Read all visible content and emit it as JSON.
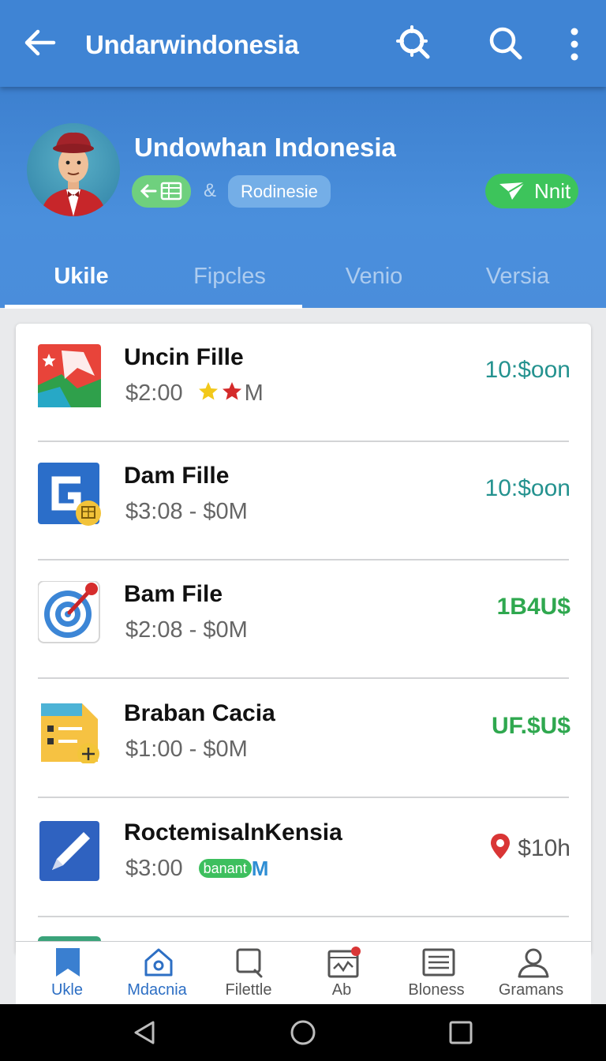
{
  "appbar": {
    "title": "Undarwindonesia"
  },
  "header": {
    "title": "Undowhan Indonesia",
    "amp": "&",
    "chip_location": "Rodinesie",
    "chip_action": "Nnit"
  },
  "tabs": [
    {
      "label": "Ukile"
    },
    {
      "label": "Fipcles"
    },
    {
      "label": "Venio"
    },
    {
      "label": "Versia"
    }
  ],
  "list": [
    {
      "name": "Uncin Fille",
      "sub": "$2:00",
      "sub_extra": "M",
      "meta": "10:$oon",
      "meta_color": "#24928f"
    },
    {
      "name": "Dam Fille",
      "sub": "$3:08 - $0M",
      "meta": "10:$oon",
      "meta_color": "#24928f"
    },
    {
      "name": "Bam File",
      "sub": "$2:08 - $0M",
      "meta": "1B4U$",
      "meta_color": "#2fa84f"
    },
    {
      "name": "Braban Cacia",
      "sub": "$1:00 - $0M",
      "meta": "UF.$U$",
      "meta_color": "#2fa84f"
    },
    {
      "name": "RoctemisalnKensia",
      "sub": "$3:00",
      "badge": "banant",
      "badge_suffix": "M",
      "meta": "$10h",
      "meta_color": "#555555"
    }
  ],
  "bottomnav": [
    {
      "label": "Ukle",
      "icon": "bookmark-icon"
    },
    {
      "label": "Mdacnia",
      "icon": "home-icon"
    },
    {
      "label": "Filettle",
      "icon": "search-square-icon"
    },
    {
      "label": "Ab",
      "icon": "chart-icon"
    },
    {
      "label": "Bloness",
      "icon": "list-icon"
    },
    {
      "label": "Gramans",
      "icon": "person-icon"
    }
  ],
  "colors": {
    "primary": "#3f84d4",
    "accent_green": "#3dc45b",
    "teal": "#24928f"
  }
}
